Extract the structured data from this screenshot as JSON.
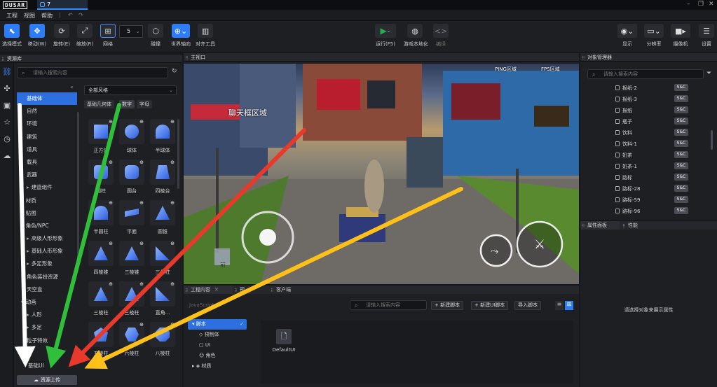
{
  "titlebar": {
    "logo": "DUSAR",
    "tab": "7"
  },
  "menu": [
    "工程",
    "视图",
    "帮助"
  ],
  "toolbar": {
    "left": [
      {
        "label": "选择模式",
        "icon": "select-cursor-icon",
        "active": true
      },
      {
        "label": "移动(W)",
        "icon": "move-icon",
        "active": true
      },
      {
        "label": "旋转(E)",
        "icon": "rotate-icon",
        "active": false
      },
      {
        "label": "缩放(R)",
        "icon": "scale-icon",
        "active": false
      },
      {
        "label": "网格",
        "icon": "grid-icon",
        "active": false
      }
    ],
    "grid_size": "5",
    "mid": [
      {
        "label": "碰撞",
        "icon": "collision-icon"
      },
      {
        "label": "世界轴向",
        "icon": "world-axis-icon"
      },
      {
        "label": "对齐工具",
        "icon": "align-icon"
      }
    ],
    "run_label": "运行(F5)",
    "localize_label": "游戏本地化",
    "compile_label": "编译",
    "right": [
      {
        "label": "显示",
        "icon": "eye-icon"
      },
      {
        "label": "分辨率",
        "icon": "monitor-icon"
      },
      {
        "label": "摄像机",
        "icon": "camera-icon"
      },
      {
        "label": "设置",
        "icon": "settings-icon"
      }
    ]
  },
  "assetlib": {
    "title": "资源库",
    "search_placeholder": "请输入搜索内容",
    "tree": [
      {
        "label": "基础体",
        "indent": 0,
        "arrow": "",
        "selected": true
      },
      {
        "label": "自然",
        "indent": 0,
        "arrow": ""
      },
      {
        "label": "环境",
        "indent": 0,
        "arrow": ""
      },
      {
        "label": "建筑",
        "indent": 0,
        "arrow": ""
      },
      {
        "label": "道具",
        "indent": 0,
        "arrow": ""
      },
      {
        "label": "载具",
        "indent": 0,
        "arrow": ""
      },
      {
        "label": "武器",
        "indent": 0,
        "arrow": ""
      },
      {
        "label": "建造组件",
        "indent": 1,
        "arrow": "▸"
      },
      {
        "label": "材质",
        "indent": 0,
        "arrow": "▸"
      },
      {
        "label": "贴图",
        "indent": 0,
        "arrow": "▸"
      },
      {
        "label": "角色/NPC",
        "indent": 0,
        "arrow": "▾"
      },
      {
        "label": "高级人形形象",
        "indent": 1,
        "arrow": "▸"
      },
      {
        "label": "基础人形形象",
        "indent": 1,
        "arrow": "▸"
      },
      {
        "label": "多足形象",
        "indent": 1,
        "arrow": "▸"
      },
      {
        "label": "角色装扮资源",
        "indent": 0,
        "arrow": ""
      },
      {
        "label": "天空盒",
        "indent": 0,
        "arrow": ""
      },
      {
        "label": "动画",
        "indent": 0,
        "arrow": "▾"
      },
      {
        "label": "人形",
        "indent": 1,
        "arrow": "▸"
      },
      {
        "label": "多足",
        "indent": 1,
        "arrow": "▸"
      },
      {
        "label": "粒子特效",
        "indent": 0,
        "arrow": ""
      }
    ],
    "ui_item": "基础UI",
    "upload_label": "资源上传",
    "style_dropdown": "全部风格",
    "chips": [
      "基础几何体",
      "数字",
      "字母"
    ],
    "grid": [
      "正方体",
      "球体",
      "半球体",
      "圆柱",
      "圆台",
      "四棱台",
      "半圆柱",
      "平面",
      "圆锥",
      "四棱锥",
      "三棱锥",
      "三角柱",
      "三棱柱",
      "三棱柱",
      "直角...",
      "五棱柱",
      "六棱柱",
      "八棱柱"
    ]
  },
  "viewport": {
    "title": "主视口",
    "chat_zone": "聊天框区域",
    "ping_zone": "PING区域",
    "fps_zone": "FPS区域",
    "bottom_label": "前"
  },
  "project": {
    "tabs": [
      "工程内容",
      "预...",
      "客户端"
    ],
    "section": "JavaScript",
    "search_placeholder": "请输入搜索内容",
    "buttons": [
      "+ 新建脚本",
      "+ 新建UI脚本",
      "导入脚本"
    ],
    "tree": [
      "脚本",
      "预制体",
      "UI",
      "角色",
      "材质"
    ],
    "file": "DefaultUI"
  },
  "objmgr": {
    "title": "对象管理器",
    "search_placeholder": "请输入搜索内容",
    "badge": "S&C",
    "rows": [
      "报纸-2",
      "报纸-3",
      "报纸",
      "瓶子",
      "饮料",
      "饮料-1",
      "奶茶",
      "奶茶-1",
      "路标",
      "路标-28",
      "路标-59",
      "路标-96"
    ]
  },
  "props": {
    "tabs": [
      "属性面板",
      "性能"
    ],
    "empty_hint": "请选择对象来展示属性"
  },
  "colors": {
    "accent": "#2e7cf6",
    "run": "#22b14c",
    "arrow_white": "#ffffff",
    "arrow_green": "#2fbf3a",
    "arrow_red": "#e8392b",
    "arrow_yellow": "#ffc01a"
  }
}
